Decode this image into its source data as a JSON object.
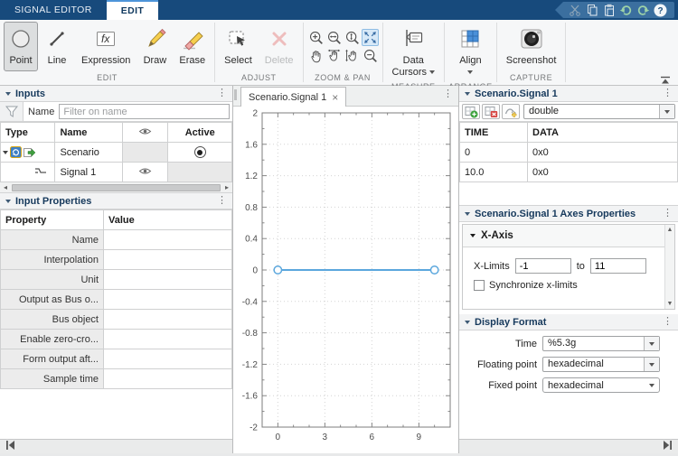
{
  "icons": {
    "menu_dots": "⋮",
    "close": "×"
  },
  "tabs": {
    "items": [
      {
        "label": "SIGNAL EDITOR",
        "active": false
      },
      {
        "label": "EDIT",
        "active": true
      }
    ]
  },
  "quick_access": {
    "icons": [
      "cut",
      "copy",
      "paste",
      "undo",
      "redo",
      "help"
    ]
  },
  "ribbon": {
    "edit": {
      "label": "EDIT",
      "buttons": {
        "point": "Point",
        "line": "Line",
        "expression": "Expression",
        "draw": "Draw",
        "erase": "Erase"
      },
      "selected": "Point"
    },
    "adjust": {
      "label": "ADJUST",
      "buttons": {
        "select": "Select",
        "delete": "Delete"
      },
      "disabled": "Delete"
    },
    "zoom_pan": {
      "label": "ZOOM & PAN",
      "icons": [
        "zoom-in",
        "zoom-in-x",
        "zoom-in-y",
        "fit-to-view",
        "pan",
        "pan-x",
        "pan-y",
        "zoom-out"
      ],
      "active_icon": "fit-to-view"
    },
    "measure": {
      "label": "MEASURE",
      "button_line1": "Data",
      "button_line2": "Cursors"
    },
    "arrange": {
      "label": "ARRANGE",
      "button": "Align"
    },
    "capture": {
      "label": "CAPTURE",
      "button": "Screenshot"
    }
  },
  "inputs_panel": {
    "title": "Inputs",
    "filter_label": "Name",
    "filter_placeholder": "Filter on name",
    "columns": {
      "type": "Type",
      "name": "Name",
      "visibility": "",
      "active": "Active"
    },
    "rows": [
      {
        "name": "Scenario",
        "type": "scenario",
        "visible": null,
        "active": true
      },
      {
        "name": "Signal 1",
        "type": "signal",
        "visible": true,
        "active": null
      }
    ]
  },
  "input_properties": {
    "title": "Input Properties",
    "columns": {
      "property": "Property",
      "value": "Value"
    },
    "rows": [
      "Name",
      "Interpolation",
      "Unit",
      "Output as Bus o...",
      "Bus object",
      "Enable zero-cro...",
      "Form output aft...",
      "Sample time"
    ],
    "values": [
      "",
      "",
      "",
      "",
      "",
      "",
      "",
      ""
    ]
  },
  "plot_tab": {
    "label": "Scenario.Signal 1"
  },
  "chart_data": {
    "type": "line",
    "title": "Scenario.Signal 1",
    "xlabel": "",
    "ylabel": "",
    "xlim": [
      -1,
      11
    ],
    "ylim": [
      -2,
      2
    ],
    "grid": "dotted",
    "xticks": {
      "values": [
        0,
        3,
        6,
        9
      ],
      "labels": [
        "0",
        "3",
        "6",
        "9"
      ],
      "minor_step": 1
    },
    "yticks": {
      "values": [
        -2,
        -1.6,
        -1.2,
        -0.8,
        -0.4,
        0,
        0.4,
        0.8,
        1.2,
        1.6,
        2
      ],
      "labels": [
        "-2",
        "-1.6",
        "-1.2",
        "-0.8",
        "-0.4",
        "0",
        "0.4",
        "0.8",
        "1.2",
        "1.6",
        "2"
      ],
      "minor_step": 0.2
    },
    "series": [
      {
        "name": "Scenario.Signal 1",
        "x": [
          0,
          10
        ],
        "y": [
          0,
          0
        ],
        "color": "#5ba7dd",
        "marker": "circle"
      }
    ]
  },
  "signal_panel": {
    "title": "Scenario.Signal 1",
    "type_value": "double",
    "columns": {
      "time": "TIME",
      "data": "DATA"
    },
    "rows": [
      [
        "0",
        "0x0"
      ],
      [
        "10.0",
        "0x0"
      ]
    ]
  },
  "axes_panel": {
    "title": "Scenario.Signal 1 Axes Properties",
    "section": "X-Axis",
    "xlimits_label": "X-Limits",
    "xmin": "-1",
    "to_label": "to",
    "xmax": "11",
    "sync_label": "Synchronize x-limits",
    "sync_checked": false
  },
  "display_format": {
    "title": "Display Format",
    "time_label": "Time",
    "time_value": "%5.3g",
    "floating_label": "Floating point",
    "floating_value": "hexadecimal",
    "fixed_label": "Fixed point",
    "fixed_value": "hexadecimal"
  }
}
